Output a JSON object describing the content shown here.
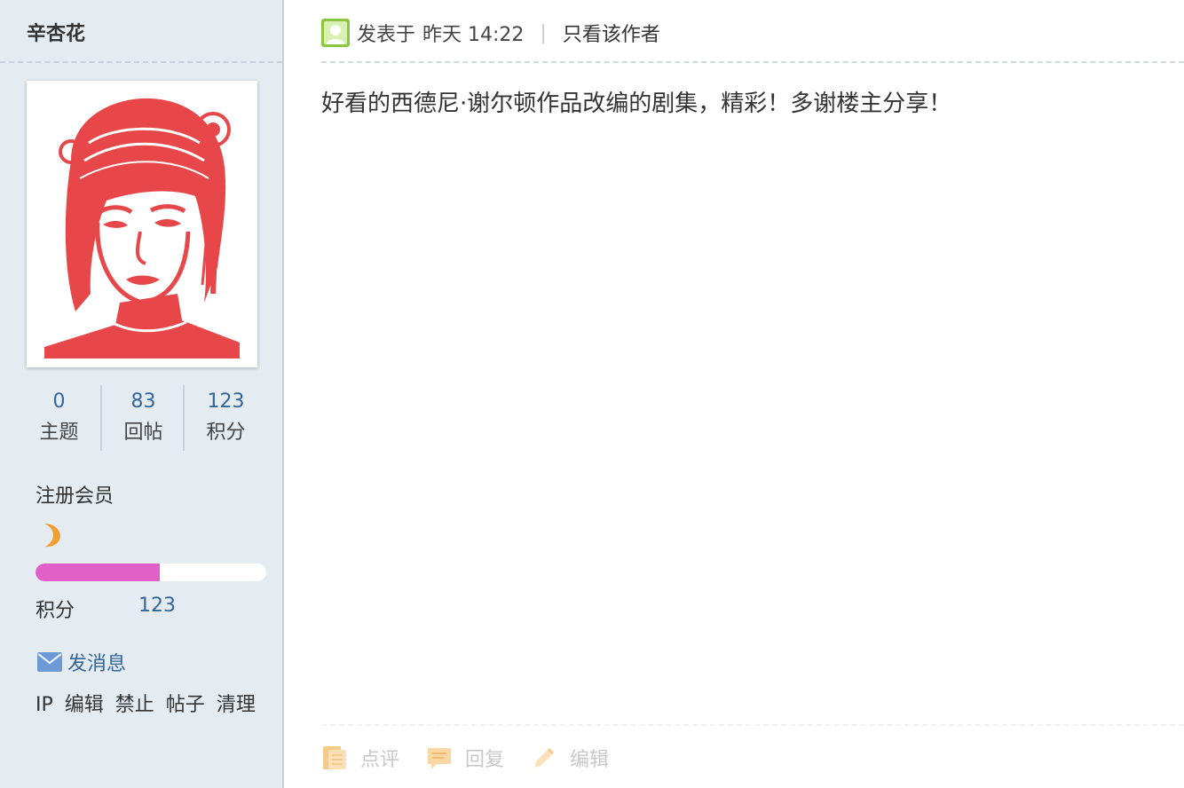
{
  "sidebar": {
    "username": "辛杏花",
    "stats": [
      {
        "value": "0",
        "label": "主题"
      },
      {
        "value": "83",
        "label": "回帖"
      },
      {
        "value": "123",
        "label": "积分"
      }
    ],
    "user_group": "注册会员",
    "level_icon": "crescent-moon-icon",
    "progress_fraction": 0.54,
    "progress_color": "#e060c8",
    "points_label": "积分",
    "points_value": "123",
    "send_message": "发消息",
    "admin_links": [
      "IP",
      "编辑",
      "禁止",
      "帖子",
      "清理"
    ]
  },
  "post": {
    "posted_prefix": "发表于",
    "posted_time": "昨天 14:22",
    "separator": "|",
    "only_author": "只看该作者",
    "body": "好看的西德尼·谢尔顿作品改编的剧集，精彩！多谢楼主分享！"
  },
  "actions": {
    "comment": "点评",
    "reply": "回复",
    "edit": "编辑"
  },
  "colors": {
    "sidebar_bg": "#e4ebf1",
    "link_blue": "#336699",
    "action_icon": "#f5c98a"
  }
}
